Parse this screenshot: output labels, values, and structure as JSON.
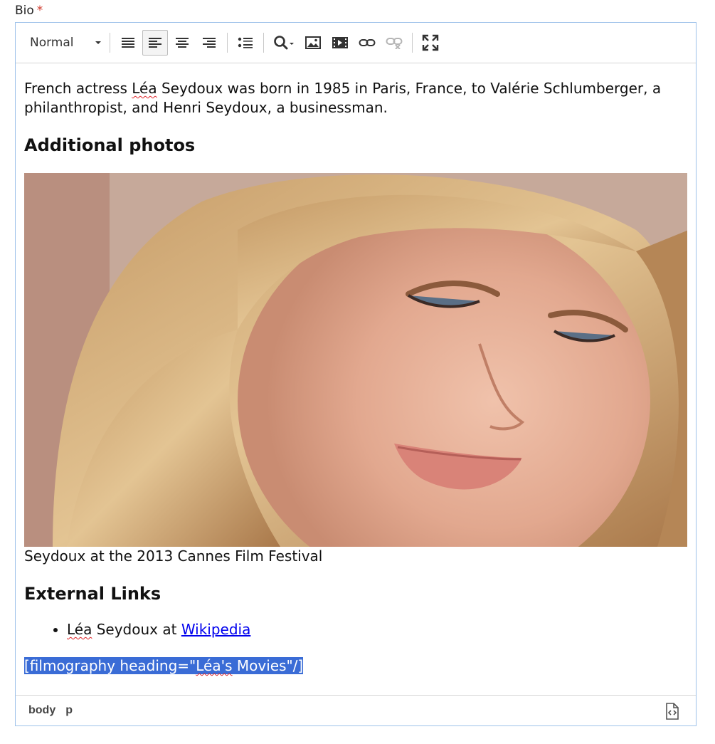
{
  "field": {
    "label": "Bio",
    "required_mark": "*"
  },
  "toolbar": {
    "format_value": "Normal",
    "buttons": [
      "justify-icon",
      "align-left-icon",
      "align-center-icon",
      "align-right-icon",
      "bulleted-list-icon",
      "search-icon",
      "image-icon",
      "video-icon",
      "link-icon",
      "unlink-icon",
      "maximize-icon"
    ],
    "active": "align-left-icon"
  },
  "content": {
    "intro_before": "French actress ",
    "intro_name": "Léa",
    "intro_after": " Seydoux was born in 1985 in Paris, France, to Valérie Schlumberger, a philanthropist, and Henri Seydoux, a businessman.",
    "heading_photos": "Additional photos",
    "photo_caption": "Seydoux at the 2013 Cannes Film Festival",
    "heading_links": "External Links",
    "link_item_name": "Léa",
    "link_item_mid": " Seydoux at ",
    "link_item_link": "Wikipedia",
    "shortcode_before": "[filmography heading=\"",
    "shortcode_name": "Léa's",
    "shortcode_after": " Movies\"/]"
  },
  "statusbar": {
    "path": [
      "body",
      "p"
    ]
  },
  "colors": {
    "selection": "#3a6cd6",
    "link": "#0000ee",
    "border": "#9ec2ea"
  }
}
